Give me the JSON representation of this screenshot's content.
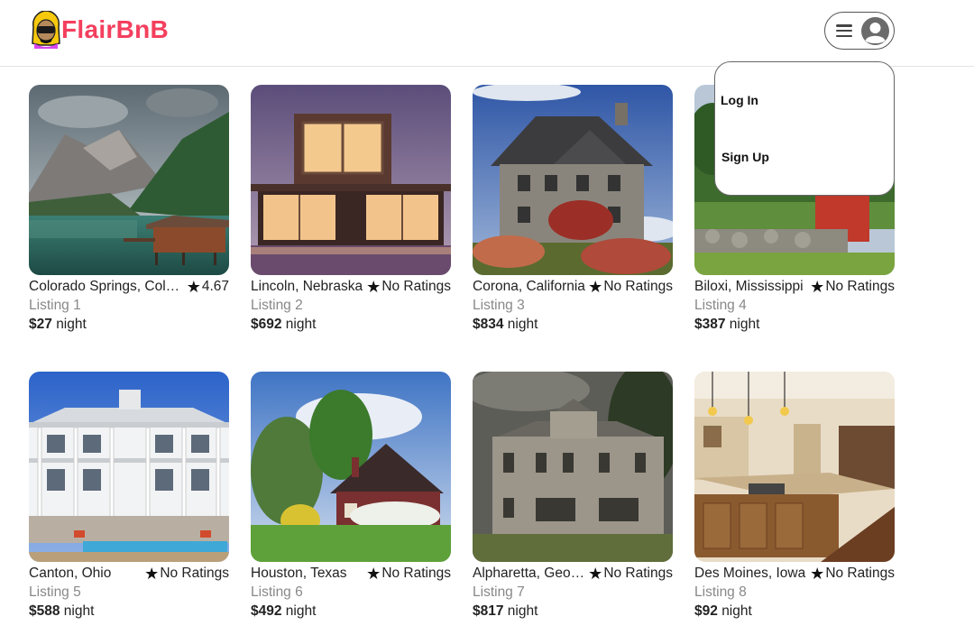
{
  "brand": {
    "name": "FlairBnB",
    "accent": "#f43f5e"
  },
  "header": {
    "menu_icon": "hamburger-icon",
    "avatar_icon": "user-avatar-icon"
  },
  "dropdown": {
    "items": [
      {
        "label": "Log In"
      },
      {
        "label": "Sign Up"
      }
    ]
  },
  "listings": [
    {
      "location": "Colorado Springs, Colorado",
      "rating": "4.67",
      "title": "Listing 1",
      "price": "$27",
      "unit": "night",
      "image": "mountain-lake-cabin"
    },
    {
      "location": "Lincoln, Nebraska",
      "rating": "No Ratings",
      "title": "Listing 2",
      "price": "$692",
      "unit": "night",
      "image": "modern-house-pool"
    },
    {
      "location": "Corona, California",
      "rating": "No Ratings",
      "title": "Listing 3",
      "price": "$834",
      "unit": "night",
      "image": "stone-house"
    },
    {
      "location": "Biloxi, Mississippi",
      "rating": "No Ratings",
      "title": "Listing 4",
      "price": "$387",
      "unit": "night",
      "image": "countryside-cottage"
    },
    {
      "location": "Canton, Ohio",
      "rating": "No Ratings",
      "title": "Listing 5",
      "price": "$588",
      "unit": "night",
      "image": "white-mansion-pool"
    },
    {
      "location": "Houston, Texas",
      "rating": "No Ratings",
      "title": "Listing 6",
      "price": "$492",
      "unit": "night",
      "image": "red-cottage-garden"
    },
    {
      "location": "Alpharetta, Georgia",
      "rating": "No Ratings",
      "title": "Listing 7",
      "price": "$817",
      "unit": "night",
      "image": "abandoned-villa"
    },
    {
      "location": "Des Moines, Iowa",
      "rating": "No Ratings",
      "title": "Listing 8",
      "price": "$92",
      "unit": "night",
      "image": "kitchen-interior"
    }
  ]
}
